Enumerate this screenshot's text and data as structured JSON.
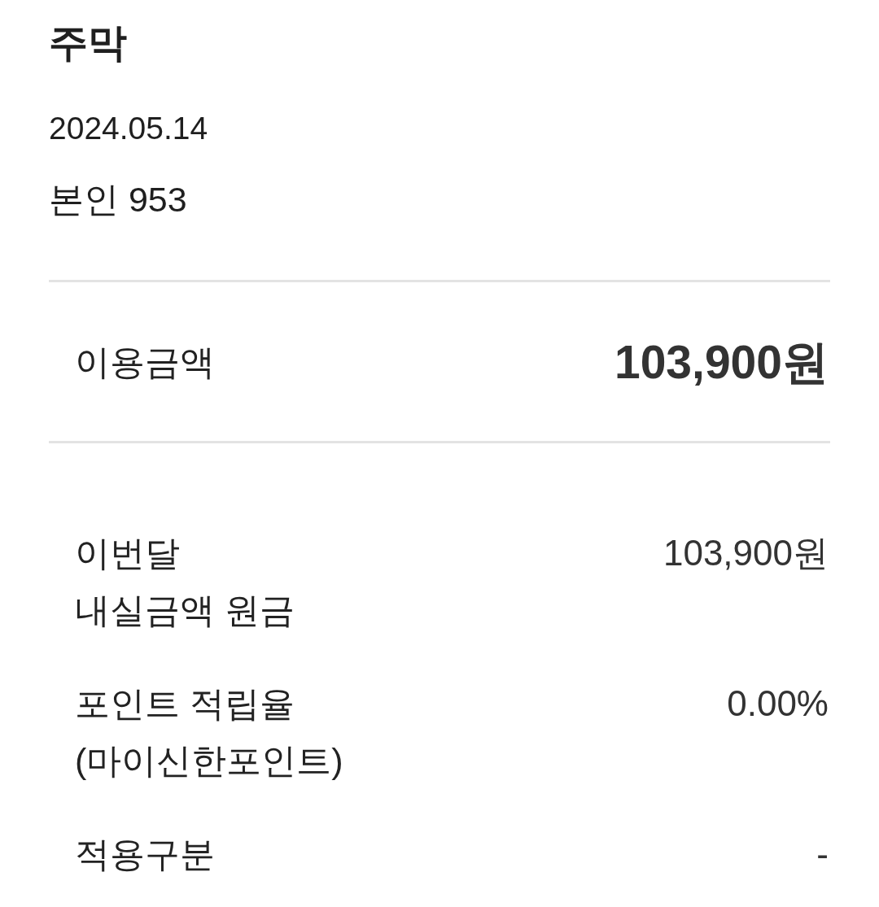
{
  "header": {
    "title": "주막",
    "date": "2024.05.14",
    "card": "본인 953"
  },
  "total": {
    "label": "이용금액",
    "amount": "103,900원"
  },
  "details": [
    {
      "label": "이번달\n내실금액 원금",
      "value": "103,900원"
    },
    {
      "label": "포인트 적립율\n(마이신한포인트)",
      "value": "0.00%"
    },
    {
      "label": "적용구분",
      "value": "-"
    }
  ]
}
